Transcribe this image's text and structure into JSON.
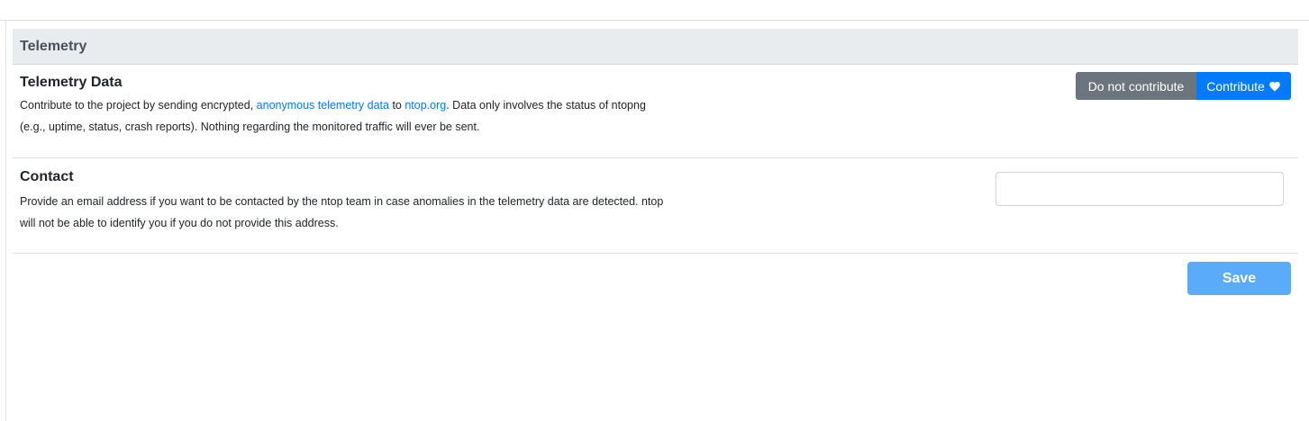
{
  "section": {
    "title": "Telemetry"
  },
  "telemetry": {
    "title": "Telemetry Data",
    "desc_prefix": "Contribute to the project by sending encrypted, ",
    "link_anonymous": "anonymous telemetry data",
    "desc_to": " to ",
    "link_ntop": "ntop.org",
    "desc_suffix": ". Data only involves the status of ntopng (e.g., uptime, status, crash reports). Nothing regarding the monitored traffic will ever be sent.",
    "btn_no_contribute": "Do not contribute",
    "btn_contribute": "Contribute",
    "btn_contribute_icon": "heart-icon"
  },
  "contact": {
    "title": "Contact",
    "desc": "Provide an email address if you want to be contacted by the ntop team in case anomalies in the telemetry data are detected. ntop will not be able to identify you if you do not provide this address.",
    "email_value": "",
    "email_placeholder": ""
  },
  "actions": {
    "save_label": "Save"
  },
  "colors": {
    "header_bg": "#e9ecef",
    "link": "#007bff",
    "btn_secondary": "#6c757d",
    "btn_primary": "#007bff",
    "save_disabled": "#5aacfb"
  }
}
